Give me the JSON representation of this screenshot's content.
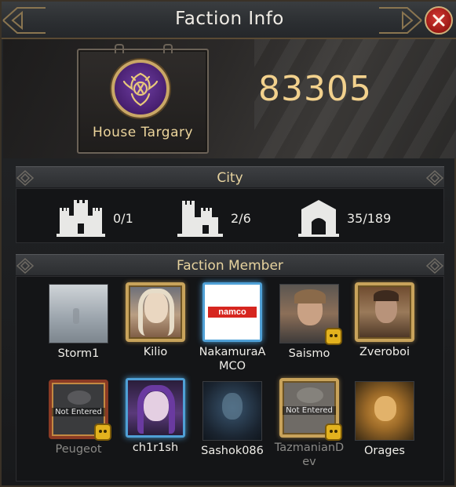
{
  "header": {
    "title": "Faction Info"
  },
  "faction": {
    "name": "House Targary",
    "score": "83305"
  },
  "city": {
    "title": "City",
    "stats": [
      {
        "icon": "castle-icon",
        "value": "0/1"
      },
      {
        "icon": "fortress-icon",
        "value": "2/6"
      },
      {
        "icon": "gate-icon",
        "value": "35/189"
      }
    ]
  },
  "members": {
    "title": "Faction Member",
    "not_entered_label": "Not Entered",
    "list": [
      {
        "name": "Storm1"
      },
      {
        "name": "Kilio"
      },
      {
        "name": "NakamuraAMCO",
        "avatar_text": "namco"
      },
      {
        "name": "Saismo"
      },
      {
        "name": "Zveroboi"
      },
      {
        "name": "Peugeot"
      },
      {
        "name": "ch1r1sh"
      },
      {
        "name": "Sashok086"
      },
      {
        "name": "TazmanianDev"
      },
      {
        "name": "Orages"
      }
    ]
  },
  "colors": {
    "accent_gold": "#f2d18d",
    "close_red": "#b3221c",
    "sigil_purple": "#5a2a8a"
  }
}
